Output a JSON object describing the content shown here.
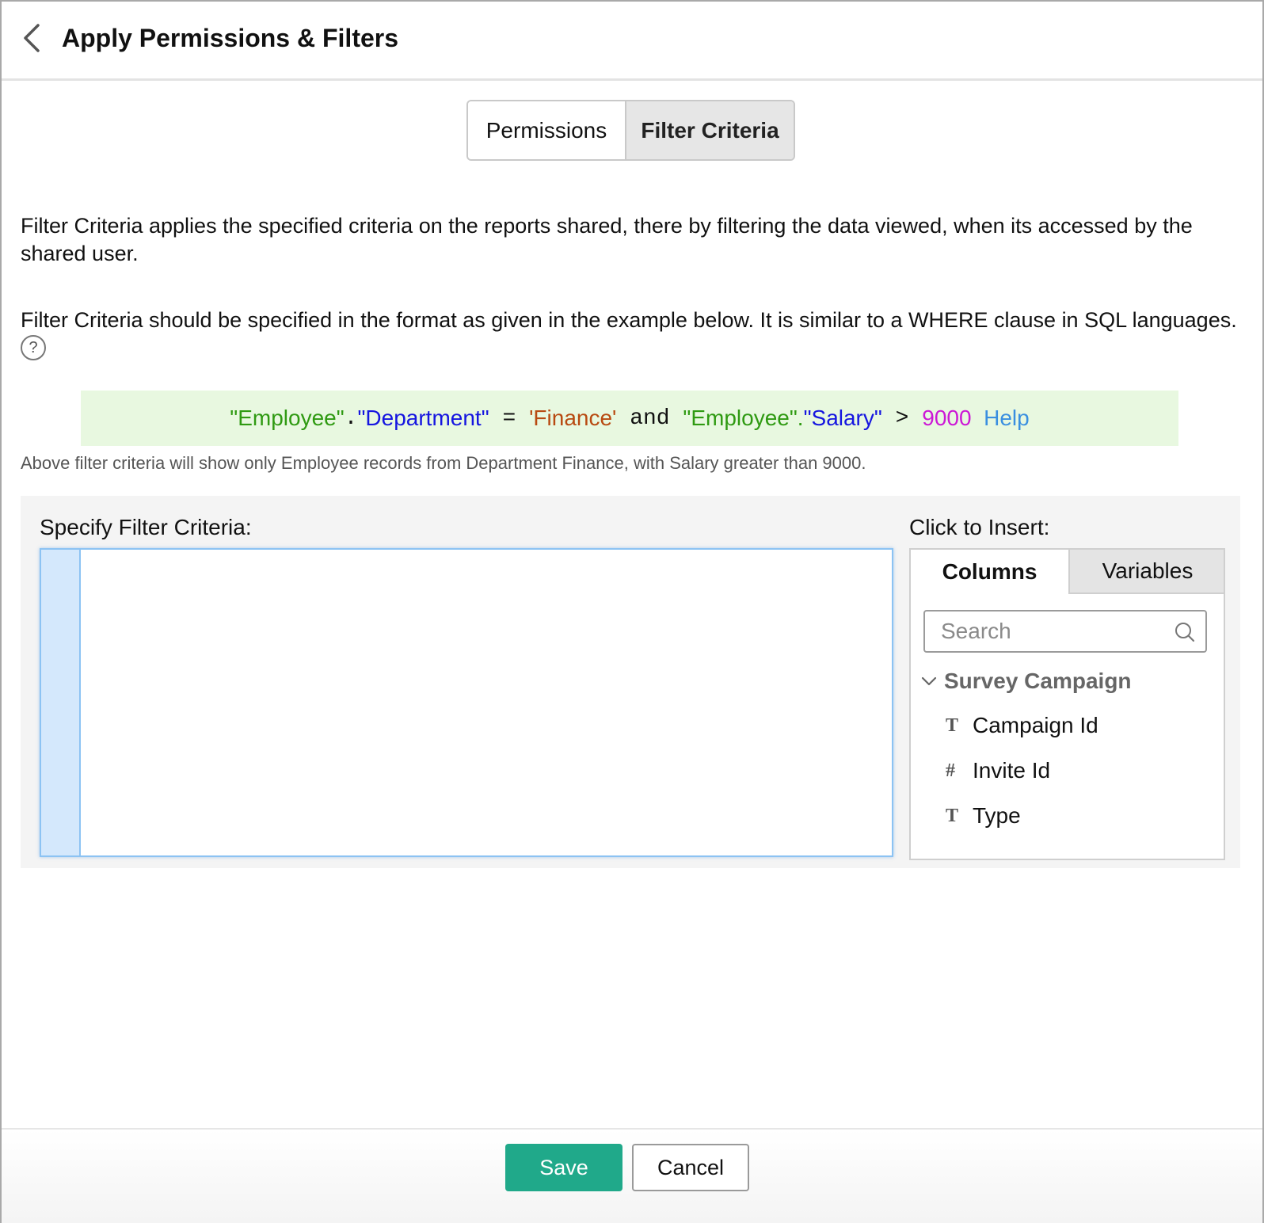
{
  "header": {
    "title": "Apply Permissions & Filters"
  },
  "tabs": {
    "permissions": "Permissions",
    "filter_criteria": "Filter Criteria",
    "active": "filter_criteria"
  },
  "description": {
    "line1": "Filter Criteria applies the specified criteria on the reports shared, there by filtering the data viewed, when its accessed by the shared user.",
    "line2": "Filter Criteria should be specified in the format as given in the example below. It is similar to a WHERE clause in SQL languages.",
    "help_icon": "?"
  },
  "example": {
    "table1": "\"Employee\"",
    "dot1": ".",
    "column1": "\"Department\"",
    "eq": " = ",
    "value1": "'Finance'",
    "and": " and ",
    "table2": "\"Employee\".",
    "column2": "\"Salary\"",
    "gt": " > ",
    "value2": "9000",
    "help": "Help",
    "note": "Above filter criteria will show only Employee records from Department Finance, with Salary greater than 9000."
  },
  "criteria": {
    "label": "Specify Filter Criteria:",
    "value": ""
  },
  "insert": {
    "label": "Click to Insert:",
    "tabs": {
      "columns": "Columns",
      "variables": "Variables"
    },
    "search_placeholder": "Search",
    "group": "Survey Campaign",
    "columns": [
      {
        "type_glyph": "T",
        "label": "Campaign Id"
      },
      {
        "type_glyph": "#",
        "label": "Invite Id"
      },
      {
        "type_glyph": "T",
        "label": "Type"
      }
    ]
  },
  "footer": {
    "save": "Save",
    "cancel": "Cancel"
  },
  "colors": {
    "accent_save": "#20a98a",
    "editor_border": "#8cc3f3",
    "example_bg": "#e8f8e0"
  }
}
